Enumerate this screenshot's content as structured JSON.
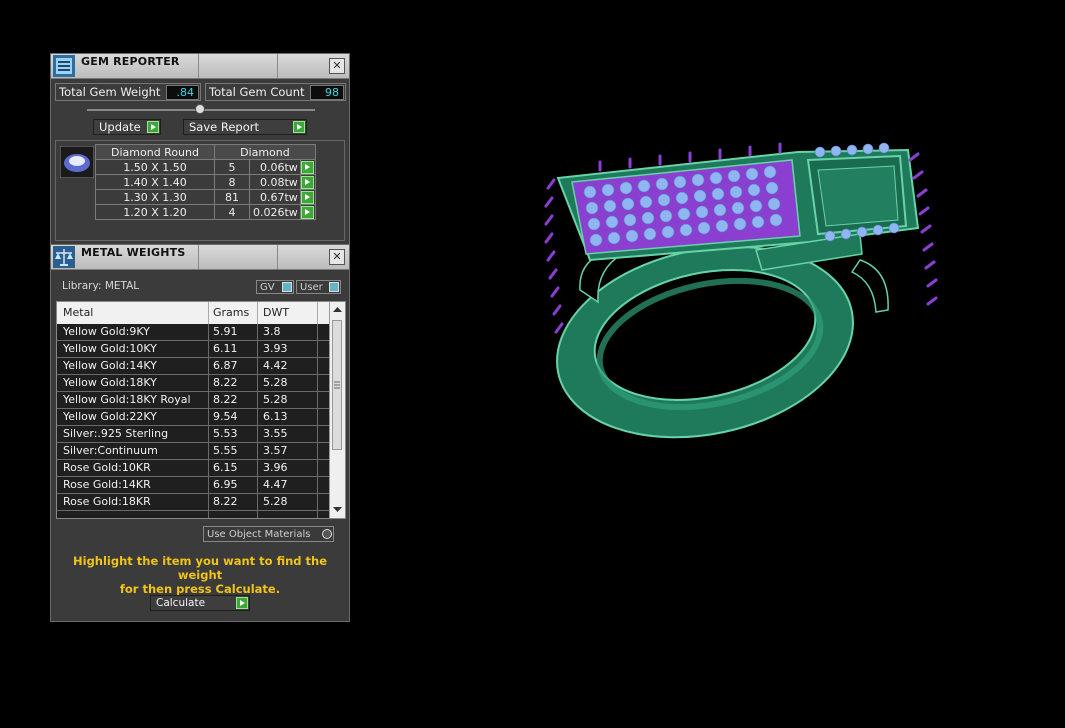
{
  "gem_reporter": {
    "title": "GEM REPORTER",
    "total_gem_weight_label": "Total Gem Weight",
    "total_gem_weight_value": ".84",
    "total_gem_count_label": "Total Gem Count",
    "total_gem_count_value": "98",
    "update_label": "Update",
    "save_report_label": "Save Report",
    "table_headers": [
      "Diamond Round",
      "Diamond"
    ],
    "rows": [
      {
        "size": "1.50 X 1.50",
        "count": "5",
        "weight": "0.06tw"
      },
      {
        "size": "1.40 X 1.40",
        "count": "8",
        "weight": "0.08tw"
      },
      {
        "size": "1.30 X 1.30",
        "count": "81",
        "weight": "0.67tw"
      },
      {
        "size": "1.20 X 1.20",
        "count": "4",
        "weight": "0.026tw"
      }
    ]
  },
  "metal_weights": {
    "title": "METAL WEIGHTS",
    "library_label": "Library: METAL",
    "gv_label": "GV",
    "user_label": "User",
    "columns": [
      "Metal",
      "Grams",
      "DWT"
    ],
    "rows": [
      {
        "metal": "Yellow Gold:9KY",
        "grams": "5.91",
        "dwt": "3.8"
      },
      {
        "metal": "Yellow Gold:10KY",
        "grams": "6.11",
        "dwt": "3.93"
      },
      {
        "metal": "Yellow Gold:14KY",
        "grams": "6.87",
        "dwt": "4.42"
      },
      {
        "metal": "Yellow Gold:18KY",
        "grams": "8.22",
        "dwt": "5.28"
      },
      {
        "metal": "Yellow Gold:18KY Royal",
        "grams": "8.22",
        "dwt": "5.28"
      },
      {
        "metal": "Yellow Gold:22KY",
        "grams": "9.54",
        "dwt": "6.13"
      },
      {
        "metal": "Silver:.925 Sterling",
        "grams": "5.53",
        "dwt": "3.55"
      },
      {
        "metal": "Silver:Continuum",
        "grams": "5.55",
        "dwt": "3.57"
      },
      {
        "metal": "Rose Gold:10KR",
        "grams": "6.15",
        "dwt": "3.96"
      },
      {
        "metal": "Rose Gold:14KR",
        "grams": "6.95",
        "dwt": "4.47"
      },
      {
        "metal": "Rose Gold:18KR",
        "grams": "8.22",
        "dwt": "5.28"
      }
    ],
    "use_object_materials_label": "Use Object Materials",
    "instruction_line1": "Highlight the item you want to find the weight",
    "instruction_line2": "for then press Calculate.",
    "calculate_label": "Calculate"
  },
  "colors": {
    "metal_green": "#1f7a5c",
    "gem_blue": "#8fb6f0",
    "prong_purple": "#8a3fd0",
    "accent_cyan": "#45d6e0",
    "instruction_yellow": "#f0c419"
  }
}
